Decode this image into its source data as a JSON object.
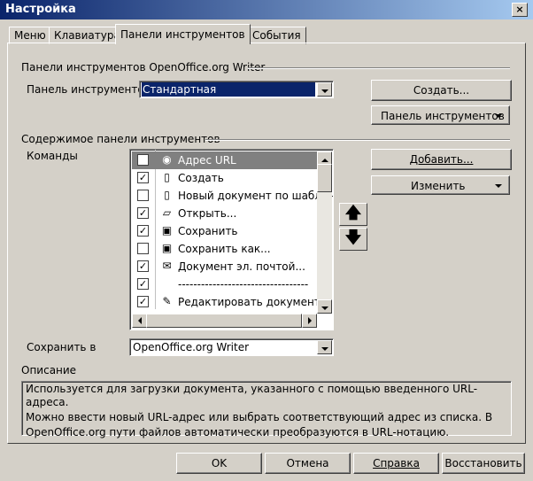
{
  "window": {
    "title": "Настройка",
    "close_label": "×"
  },
  "tabs": [
    {
      "label": "Меню"
    },
    {
      "label": "Клавиатура"
    },
    {
      "label": "Панели инструментов"
    },
    {
      "label": "События"
    }
  ],
  "toolbars_section": {
    "heading": "Панели инструментов OpenOffice.org Writer",
    "toolbar_label": "Панель инструментов",
    "toolbar_value": "Стандартная",
    "create_button": "Создать...",
    "toolbar_menu_button": "Панель инструментов"
  },
  "contents_section": {
    "heading": "Содержимое панели инструментов",
    "commands_label": "Команды",
    "add_button": "Добавить...",
    "modify_button": "Изменить",
    "commands": [
      {
        "label": "Адрес URL",
        "checked": false,
        "icon": "globe-icon",
        "glyph": "◉"
      },
      {
        "label": "Создать",
        "checked": true,
        "icon": "new-document-icon",
        "glyph": "▯"
      },
      {
        "label": "Новый документ по шаблону",
        "checked": false,
        "icon": "template-document-icon",
        "glyph": "▯"
      },
      {
        "label": "Открыть...",
        "checked": true,
        "icon": "open-folder-icon",
        "glyph": "▱"
      },
      {
        "label": "Сохранить",
        "checked": true,
        "icon": "save-icon",
        "glyph": "▣"
      },
      {
        "label": "Сохранить как...",
        "checked": false,
        "icon": "save-as-icon",
        "glyph": "▣"
      },
      {
        "label": "Документ эл. почтой...",
        "checked": true,
        "icon": "mail-icon",
        "glyph": "✉"
      },
      {
        "label": "----------------------------------",
        "checked": true,
        "icon": "",
        "glyph": ""
      },
      {
        "label": "Редактировать документ",
        "checked": true,
        "icon": "edit-document-icon",
        "glyph": "✎"
      }
    ],
    "check_mark": "✓",
    "move_up": "🡅",
    "move_down": "🡇"
  },
  "save_in": {
    "label": "Сохранить в",
    "value": "OpenOffice.org Writer"
  },
  "description": {
    "label": "Описание",
    "lines": [
      "Используется для загрузки документа, указанного с помощью введенного URL-адреса.",
      "Можно ввести новый URL-адрес или выбрать соответствующий адрес из списка. В",
      "OpenOffice.org пути файлов автоматически преобразуются в URL-нотацию."
    ]
  },
  "buttons": {
    "ok": "OK",
    "cancel": "Отмена",
    "help": "Справка",
    "reset": "Восстановить"
  },
  "colors": {
    "title_bar": "#0a246a",
    "selection": "#0a246a",
    "face": "#d4d0c8"
  }
}
